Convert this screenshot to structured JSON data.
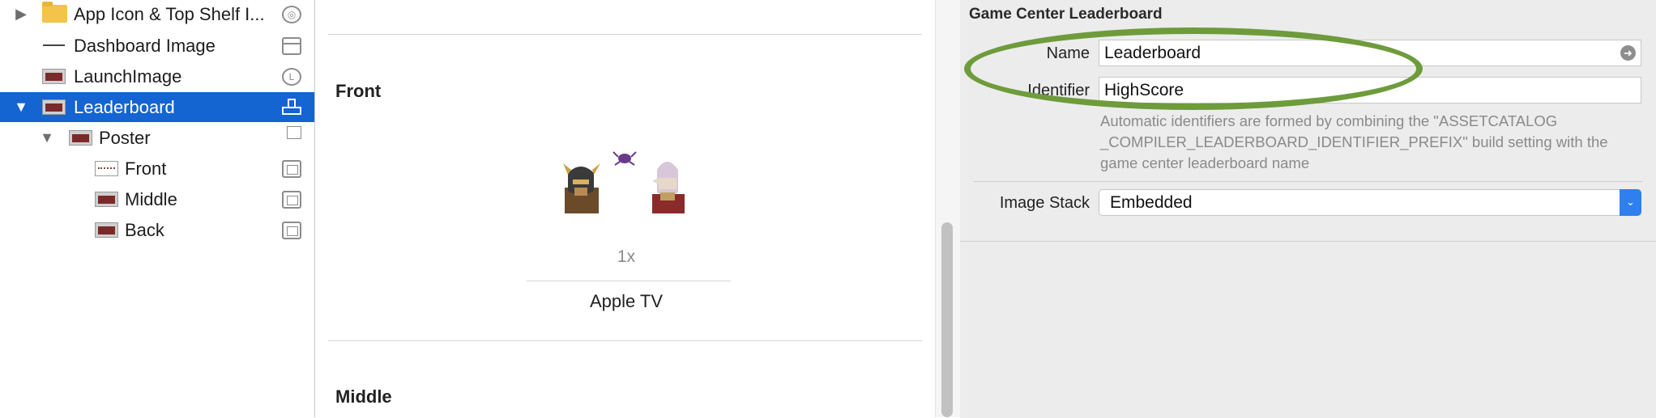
{
  "sidebar": {
    "items": [
      {
        "label": "App Icon & Top Shelf I...",
        "disclosure": "▶",
        "thumb": "folder",
        "role_icon": "circle"
      },
      {
        "label": "Dashboard Image",
        "disclosure": "",
        "thumb": "line",
        "role_icon": "panel"
      },
      {
        "label": "LaunchImage",
        "disclosure": "",
        "thumb": "dark",
        "role_icon": "L"
      },
      {
        "label": "Leaderboard",
        "disclosure": "▼",
        "thumb": "dark",
        "role_icon": "leaderboard-icon",
        "selected": true
      },
      {
        "label": "Poster",
        "disclosure": "▼",
        "thumb": "dark",
        "role_icon": "stack"
      },
      {
        "label": "Front",
        "disclosure": "",
        "thumb": "front",
        "role_icon": "square"
      },
      {
        "label": "Middle",
        "disclosure": "",
        "thumb": "dark",
        "role_icon": "square"
      },
      {
        "label": "Back",
        "disclosure": "",
        "thumb": "dark",
        "role_icon": "square"
      }
    ]
  },
  "editor": {
    "sections": [
      {
        "title": "Front"
      },
      {
        "title": "Middle"
      }
    ],
    "slot_scale": "1x",
    "device": "Apple TV"
  },
  "inspector": {
    "title": "Game Center Leaderboard",
    "name_label": "Name",
    "name_value": "Leaderboard",
    "identifier_label": "Identifier",
    "identifier_value": "HighScore",
    "help_text": "Automatic identifiers are formed by combining the \"ASSETCATALOG _COMPILER_LEADERBOARD_IDENTIFIER_PREFIX\" build setting with the game center leaderboard name",
    "image_stack_label": "Image Stack",
    "image_stack_value": "Embedded"
  },
  "colors": {
    "selection": "#1464d2",
    "annotation": "#6e9b3b",
    "popup_accent": "#2f7ff0"
  }
}
